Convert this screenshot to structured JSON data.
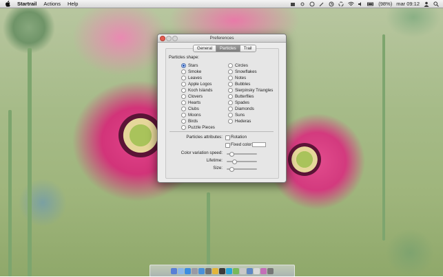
{
  "menubar": {
    "app_name": "Startrail",
    "menus": [
      "Actions",
      "Help"
    ],
    "battery": "(98%)",
    "clock": "mar 09:12"
  },
  "window": {
    "title": "Preferences",
    "tabs": [
      {
        "label": "General",
        "selected": false
      },
      {
        "label": "Particles",
        "selected": true
      },
      {
        "label": "Trail",
        "selected": false
      }
    ]
  },
  "particles": {
    "shape_label": "Particles shape:",
    "shapes_left": [
      "Stars",
      "Smoke",
      "Leaves",
      "Apple Logos",
      "Koch Islands",
      "Clovers",
      "Hearts",
      "Clubs",
      "Moons",
      "Birds",
      "Puzzle Pieces"
    ],
    "shapes_right": [
      "Circles",
      "Snowflakes",
      "Notes",
      "Bubbles",
      "Sierpinsky Triangles",
      "Butterflies",
      "Spades",
      "Diamonds",
      "Suns",
      "Hederas"
    ],
    "selected_shape": "Stars",
    "attributes_label": "Particles attributes:",
    "rotation_label": "Rotation",
    "fixed_color_label": "Fixed color:",
    "color_variation_label": "Color variation speed:",
    "lifetime_label": "Lifetime:",
    "size_label": "Size:",
    "color_variation_value": 0.1,
    "lifetime_value": 0.2,
    "size_value": 0.1
  },
  "colors": {
    "selected_tab": "#8a8a8a",
    "close_button": "#e25c50",
    "radio_selected": "#1e4fa8"
  }
}
